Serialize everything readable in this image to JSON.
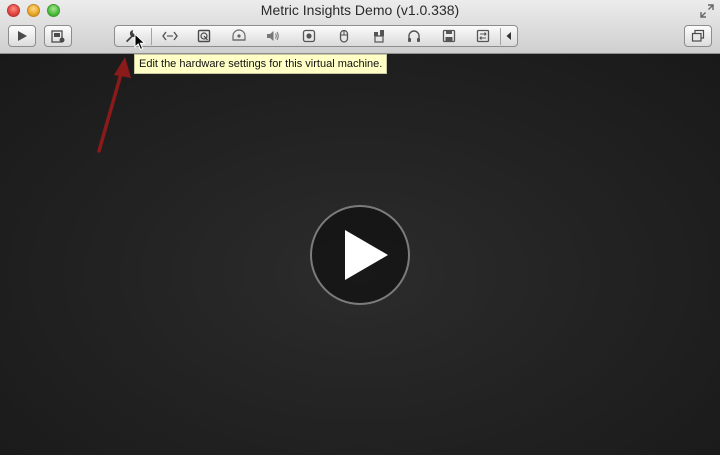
{
  "window": {
    "title": "Metric Insights Demo (v1.0.338)"
  },
  "toolbar": {
    "left_buttons": [
      {
        "icon": "play-icon"
      },
      {
        "icon": "snapshot-icon"
      }
    ],
    "tools": [
      {
        "icon": "wrench-icon",
        "tooltip": "Edit the hardware settings for this virtual machine."
      },
      {
        "icon": "network-icon"
      },
      {
        "icon": "hard-disk-icon"
      },
      {
        "icon": "optical-drive-icon"
      },
      {
        "icon": "sound-icon"
      },
      {
        "icon": "camera-icon"
      },
      {
        "icon": "mouse-icon"
      },
      {
        "icon": "usb-icon"
      },
      {
        "icon": "headphones-icon"
      },
      {
        "icon": "floppy-icon"
      },
      {
        "icon": "shared-folder-icon"
      }
    ],
    "right_button": {
      "icon": "windows-icon"
    }
  },
  "tooltip": {
    "text": "Edit the hardware settings for this virtual machine."
  },
  "colors": {
    "annotation_arrow": "#8b1a1a",
    "tooltip_bg": "#ffffc6",
    "viewport_bg": "#1f1f1f"
  }
}
